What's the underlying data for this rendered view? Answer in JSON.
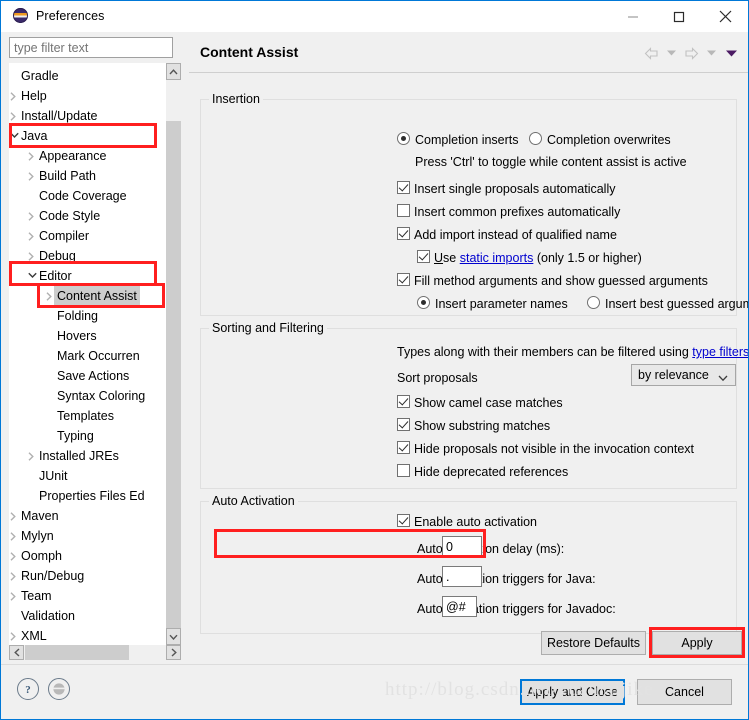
{
  "window": {
    "title": "Preferences",
    "icon": "eclipse-icon",
    "minimize": "minimize",
    "maximize": "maximize",
    "close": "close"
  },
  "filter": {
    "placeholder": "type filter text",
    "value": ""
  },
  "tree": {
    "items": [
      {
        "label": "Gradle",
        "indent": 0,
        "arrow": "none"
      },
      {
        "label": "Help",
        "indent": 0,
        "arrow": "right"
      },
      {
        "label": "Install/Update",
        "indent": 0,
        "arrow": "right"
      },
      {
        "label": "Java",
        "indent": 0,
        "arrow": "down"
      },
      {
        "label": "Appearance",
        "indent": 1,
        "arrow": "right"
      },
      {
        "label": "Build Path",
        "indent": 1,
        "arrow": "right"
      },
      {
        "label": "Code Coverage",
        "indent": 1,
        "arrow": "none"
      },
      {
        "label": "Code Style",
        "indent": 1,
        "arrow": "right"
      },
      {
        "label": "Compiler",
        "indent": 1,
        "arrow": "right"
      },
      {
        "label": "Debug",
        "indent": 1,
        "arrow": "right"
      },
      {
        "label": "Editor",
        "indent": 1,
        "arrow": "down"
      },
      {
        "label": "Content Assist",
        "indent": 2,
        "arrow": "right",
        "selected": true
      },
      {
        "label": "Folding",
        "indent": 2,
        "arrow": "none"
      },
      {
        "label": "Hovers",
        "indent": 2,
        "arrow": "none"
      },
      {
        "label": "Mark Occurren",
        "indent": 2,
        "arrow": "none"
      },
      {
        "label": "Save Actions",
        "indent": 2,
        "arrow": "none"
      },
      {
        "label": "Syntax Coloring",
        "indent": 2,
        "arrow": "none"
      },
      {
        "label": "Templates",
        "indent": 2,
        "arrow": "none"
      },
      {
        "label": "Typing",
        "indent": 2,
        "arrow": "none"
      },
      {
        "label": "Installed JREs",
        "indent": 1,
        "arrow": "right"
      },
      {
        "label": "JUnit",
        "indent": 1,
        "arrow": "none"
      },
      {
        "label": "Properties Files Ed",
        "indent": 1,
        "arrow": "none"
      },
      {
        "label": "Maven",
        "indent": 0,
        "arrow": "right"
      },
      {
        "label": "Mylyn",
        "indent": 0,
        "arrow": "right"
      },
      {
        "label": "Oomph",
        "indent": 0,
        "arrow": "right"
      },
      {
        "label": "Run/Debug",
        "indent": 0,
        "arrow": "right"
      },
      {
        "label": "Team",
        "indent": 0,
        "arrow": "right"
      },
      {
        "label": "Validation",
        "indent": 0,
        "arrow": "none"
      },
      {
        "label": "XML",
        "indent": 0,
        "arrow": "right"
      }
    ]
  },
  "page": {
    "title": "Content Assist",
    "nav": {
      "back": "back-arrow",
      "back_menu": "back-dropdown",
      "forward": "forward-arrow",
      "forward_menu": "forward-dropdown",
      "view_menu": "view-menu-dropdown"
    },
    "insertion": {
      "legend": "Insertion",
      "completion_inserts": "Completion inserts",
      "completion_overwrites": "Completion overwrites",
      "hint": "Press 'Ctrl' to toggle while content assist is active",
      "insert_single": "Insert single proposals automatically",
      "insert_common_prefixes": "Insert common prefixes automatically",
      "add_import": "Add import instead of qualified name",
      "use_static_pre": "U",
      "use_static_rest": "se ",
      "static_imports_link": "static imports",
      "use_static_suffix": " (only 1.5 or higher)",
      "fill_method_args": "Fill method arguments and show guessed arguments",
      "insert_param_names": "Insert parameter names",
      "insert_best_guessed": "Insert best guessed arguments"
    },
    "sorting": {
      "legend": "Sorting and Filtering",
      "desc_pre": "Types along with their members can be filtered using ",
      "desc_link": "type filters",
      "desc_post": ".",
      "sort_proposals_label": "Sort proposals",
      "sort_proposals_value": "by relevance",
      "show_camel_case": "Show camel case matches",
      "show_substring": "Show substring matches",
      "hide_not_visible": "Hide proposals not visible in the invocation context",
      "hide_deprecated": "Hide deprecated references"
    },
    "auto_activation": {
      "legend": "Auto Activation",
      "enable": "Enable auto activation",
      "delay_label": "Auto activation delay (ms):",
      "delay_value": "0",
      "java_label": "Auto activation triggers for Java:",
      "java_value": ".",
      "javadoc_label": "Auto activation triggers for Javadoc:",
      "javadoc_value": "@#"
    },
    "restore_defaults": "Restore Defaults",
    "apply": "Apply"
  },
  "footer": {
    "help": "help-icon",
    "eclipse": "eclipse-icon",
    "apply_and_close": "Apply and Close",
    "cancel": "Cancel"
  },
  "watermark": "http://blog.csdn.net/yuanlaijike",
  "colors": {
    "accent": "#0078d7",
    "highlight_box": "#ff1f1f",
    "link": "#0000cf",
    "selection": "#cdcdcd"
  }
}
